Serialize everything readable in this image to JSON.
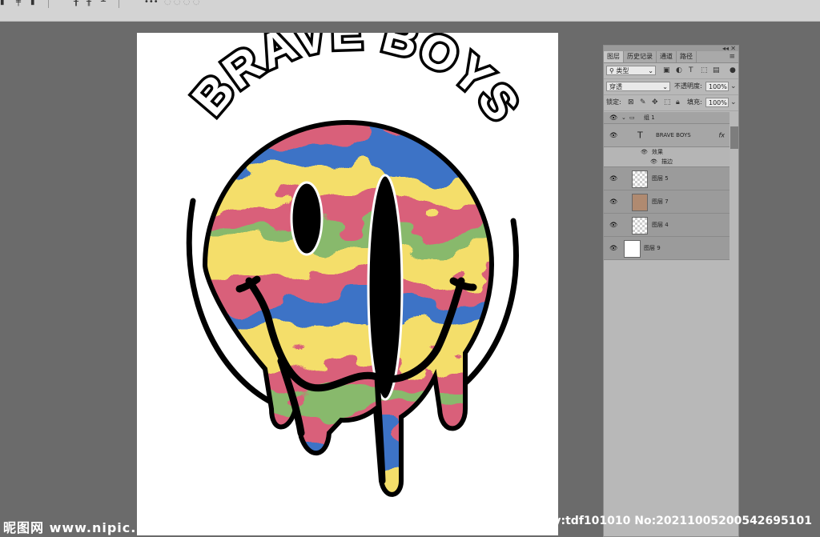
{
  "toolbar": {
    "icons": [
      "align-left-icon",
      "align-center-icon",
      "align-right-icon",
      "distribute-icon",
      "distribute-v-icon",
      "distribute-h-icon",
      "more-icon",
      "3d-mode-icon"
    ]
  },
  "canvas": {
    "artwork": {
      "title": "BRAVE BOYS",
      "colors": {
        "swirl_pink": "#d9607a",
        "swirl_yellow": "#f4de6a",
        "swirl_blue": "#3e73c6",
        "swirl_green": "#88b96c",
        "outline": "#000000"
      }
    }
  },
  "layers_panel": {
    "tabs": [
      "图层",
      "历史记录",
      "通道",
      "路径"
    ],
    "active_tab": "图层",
    "filter": {
      "label": "类型"
    },
    "blend_mode": "穿透",
    "opacity_label": "不透明度:",
    "opacity_value": "100%",
    "lock_label": "锁定:",
    "fill_label": "填充:",
    "fill_value": "100%",
    "layers": [
      {
        "name": "组 1",
        "kind": "group"
      },
      {
        "name": "BRAVE BOYS",
        "kind": "text",
        "fx": "fx"
      },
      {
        "name": "效果",
        "kind": "effect"
      },
      {
        "name": "描边",
        "kind": "effect-item"
      },
      {
        "name": "图层 5",
        "kind": "layer"
      },
      {
        "name": "图层 7",
        "kind": "layer"
      },
      {
        "name": "图层 4",
        "kind": "layer"
      },
      {
        "name": "图层 9",
        "kind": "background"
      }
    ]
  },
  "watermark": {
    "left": "昵图网 www.nipic.com",
    "right": "By:tdf101010 No:20211005200542695101"
  }
}
